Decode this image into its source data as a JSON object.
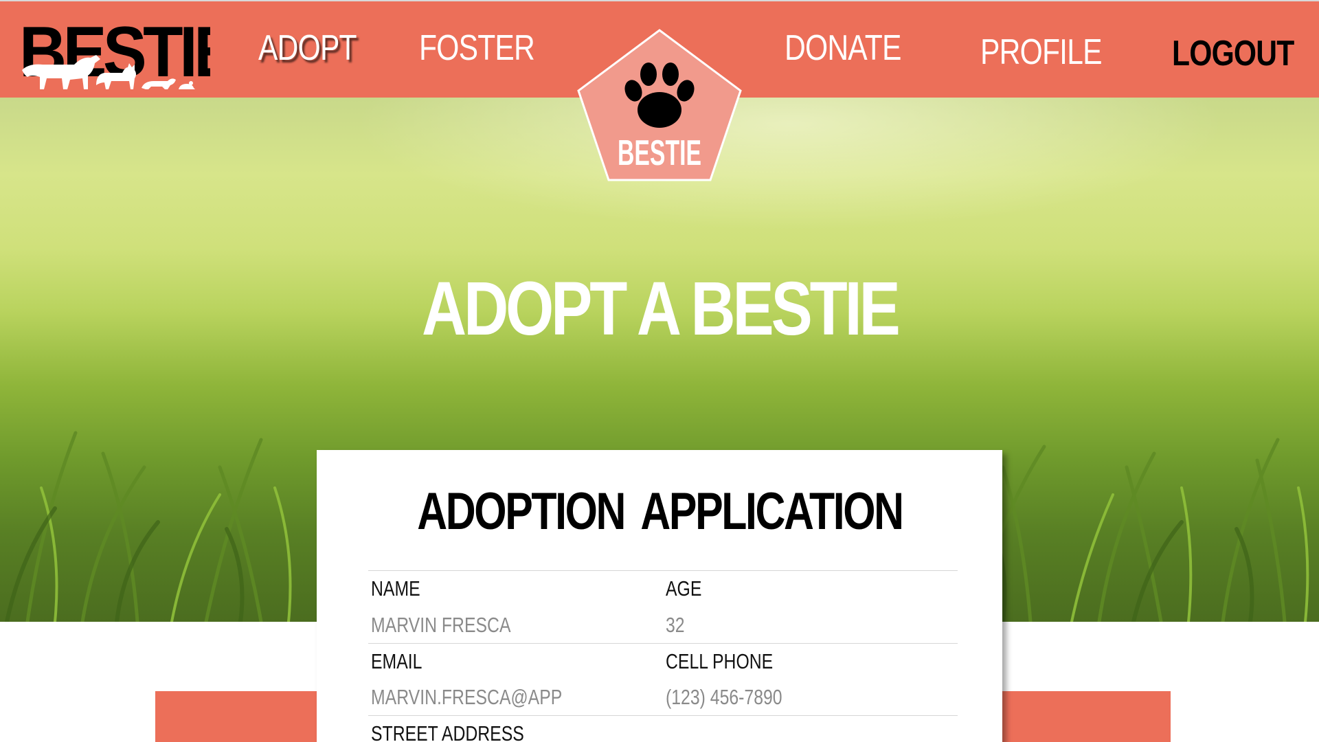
{
  "brand": {
    "logo_text": "BESTIE"
  },
  "nav": {
    "adopt": "ADOPT",
    "foster": "FOSTER",
    "donate": "DONATE",
    "profile": "PROFILE",
    "logout": "LOGOUT"
  },
  "badge": {
    "label": "BESTIE",
    "icon": "paw-icon"
  },
  "hero": {
    "title": "ADOPT A BESTIE"
  },
  "application": {
    "title": "ADOPTION  APPLICATION",
    "fields": {
      "name": {
        "label": "NAME",
        "value": "MARVIN FRESCA"
      },
      "age": {
        "label": "AGE",
        "value": "32"
      },
      "email": {
        "label": "EMAIL",
        "value": "MARVIN.FRESCA@APP"
      },
      "cell_phone": {
        "label": "CELL PHONE",
        "value": "(123) 456-7890"
      },
      "street_address": {
        "label": "STREET ADDRESS"
      }
    }
  },
  "colors": {
    "accent": "#ec6f59",
    "badge_fill": "#f19a8c",
    "label_text": "#111111",
    "value_text": "#8a8a8a"
  }
}
